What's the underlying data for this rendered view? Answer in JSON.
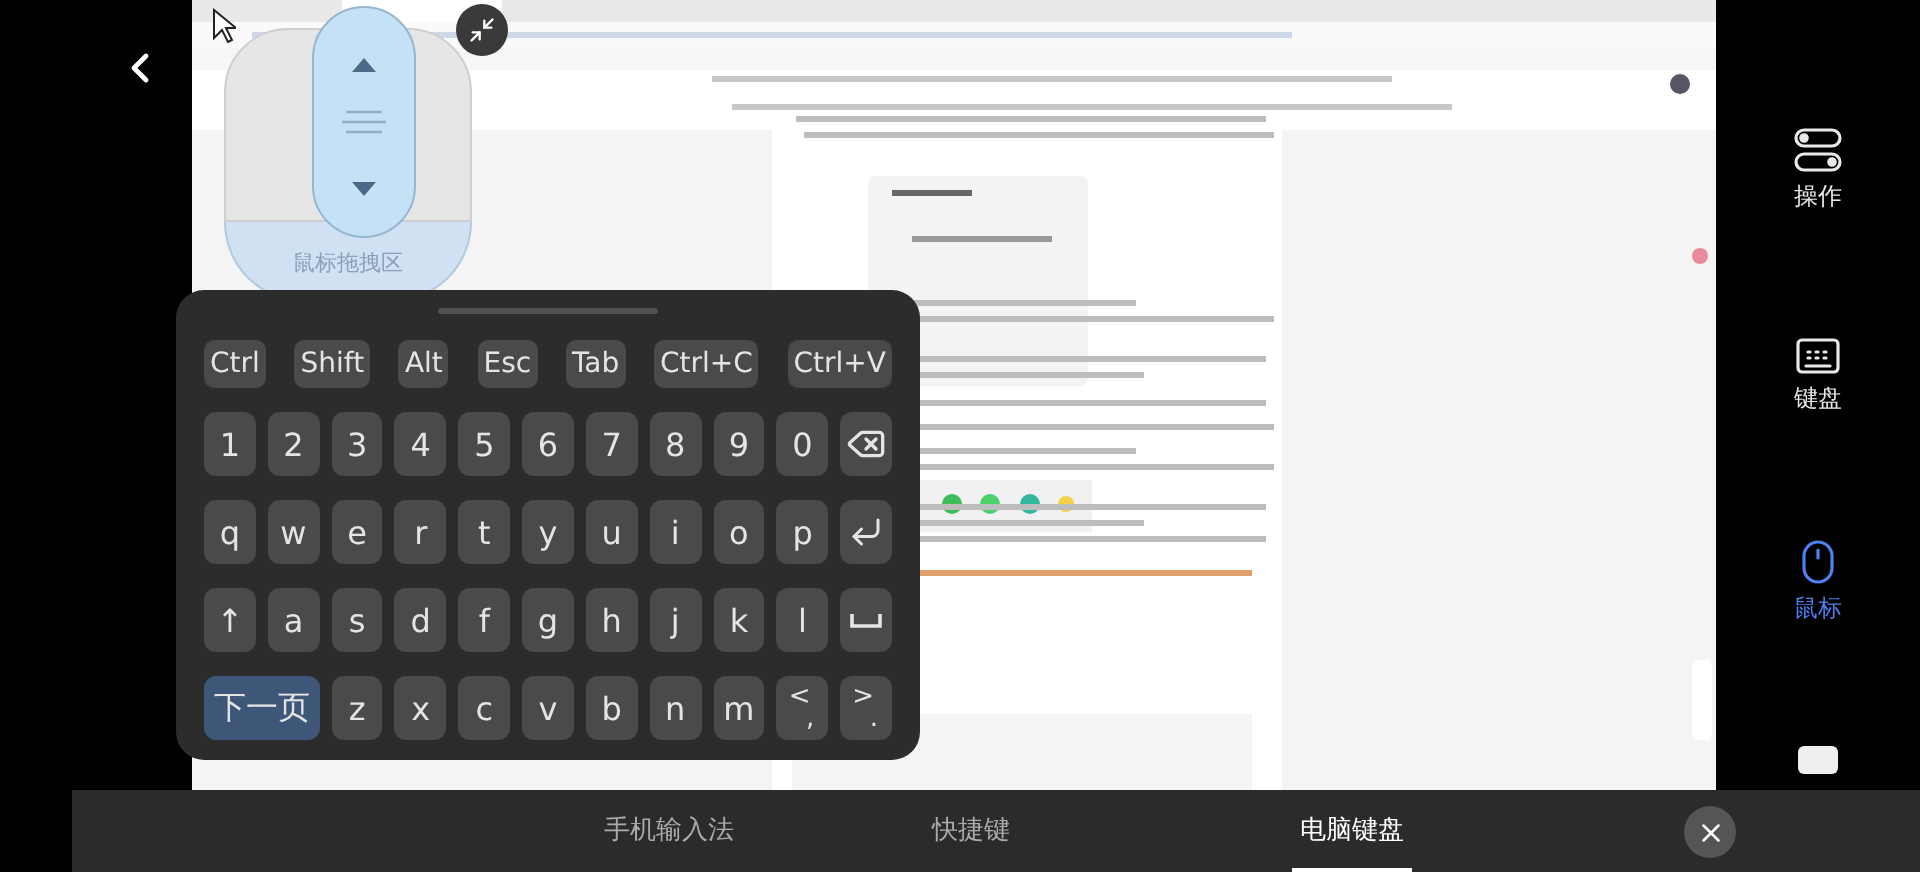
{
  "mouse_pad": {
    "label": "鼠标拖拽区"
  },
  "keyboard": {
    "modifier_keys": [
      {
        "label": "Ctrl"
      },
      {
        "label": "Shift"
      },
      {
        "label": "Alt"
      },
      {
        "label": "Esc"
      },
      {
        "label": "Tab"
      },
      {
        "label": "Ctrl+C"
      },
      {
        "label": "Ctrl+V"
      }
    ],
    "rows": [
      [
        {
          "kind": "text",
          "label": "1"
        },
        {
          "kind": "text",
          "label": "2"
        },
        {
          "kind": "text",
          "label": "3"
        },
        {
          "kind": "text",
          "label": "4"
        },
        {
          "kind": "text",
          "label": "5"
        },
        {
          "kind": "text",
          "label": "6"
        },
        {
          "kind": "text",
          "label": "7"
        },
        {
          "kind": "text",
          "label": "8"
        },
        {
          "kind": "text",
          "label": "9"
        },
        {
          "kind": "text",
          "label": "0"
        },
        {
          "kind": "backspace"
        }
      ],
      [
        {
          "kind": "text",
          "label": "q"
        },
        {
          "kind": "text",
          "label": "w"
        },
        {
          "kind": "text",
          "label": "e"
        },
        {
          "kind": "text",
          "label": "r"
        },
        {
          "kind": "text",
          "label": "t"
        },
        {
          "kind": "text",
          "label": "y"
        },
        {
          "kind": "text",
          "label": "u"
        },
        {
          "kind": "text",
          "label": "i"
        },
        {
          "kind": "text",
          "label": "o"
        },
        {
          "kind": "text",
          "label": "p"
        },
        {
          "kind": "enter"
        }
      ],
      [
        {
          "kind": "text",
          "label": "↑"
        },
        {
          "kind": "text",
          "label": "a"
        },
        {
          "kind": "text",
          "label": "s"
        },
        {
          "kind": "text",
          "label": "d"
        },
        {
          "kind": "text",
          "label": "f"
        },
        {
          "kind": "text",
          "label": "g"
        },
        {
          "kind": "text",
          "label": "h"
        },
        {
          "kind": "text",
          "label": "j"
        },
        {
          "kind": "text",
          "label": "k"
        },
        {
          "kind": "text",
          "label": "l"
        },
        {
          "kind": "space"
        }
      ],
      [
        {
          "kind": "accent",
          "label": "下一页"
        },
        "",
        {
          "kind": "text",
          "label": "z"
        },
        {
          "kind": "text",
          "label": "x"
        },
        {
          "kind": "text",
          "label": "c"
        },
        {
          "kind": "text",
          "label": "v"
        },
        {
          "kind": "text",
          "label": "b"
        },
        {
          "kind": "text",
          "label": "n"
        },
        {
          "kind": "text",
          "label": "m"
        },
        {
          "kind": "dual",
          "top": "<",
          "bottom": ","
        },
        {
          "kind": "dual",
          "top": ">",
          "bottom": "."
        }
      ]
    ]
  },
  "side_menu": [
    {
      "label": "操作",
      "selected": false
    },
    {
      "label": "键盘",
      "selected": false
    },
    {
      "label": "鼠标",
      "selected": true
    }
  ],
  "bottom_tabs": [
    {
      "label": "手机输入法",
      "selected": false
    },
    {
      "label": "快捷键",
      "selected": false
    },
    {
      "label": "电脑键盘",
      "selected": true
    }
  ]
}
